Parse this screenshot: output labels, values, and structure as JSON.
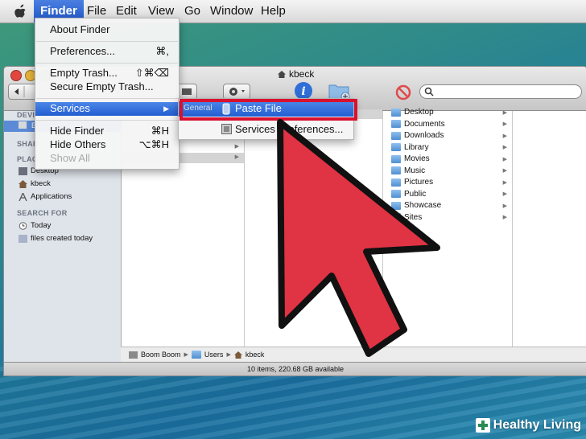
{
  "menubar": {
    "items": [
      "Finder",
      "File",
      "Edit",
      "View",
      "Go",
      "Window",
      "Help"
    ],
    "active_index": 0
  },
  "finder_menu": {
    "items": [
      {
        "label": "About Finder",
        "shortcut": ""
      },
      {
        "label": "Preferences...",
        "shortcut": "⌘,"
      },
      {
        "label": "Empty Trash...",
        "shortcut": "⇧⌘⌫"
      },
      {
        "label": "Secure Empty Trash...",
        "shortcut": ""
      },
      {
        "label": "Services",
        "shortcut": "▶"
      },
      {
        "label": "Hide Finder",
        "shortcut": "⌘H"
      },
      {
        "label": "Hide Others",
        "shortcut": "⌥⌘H"
      },
      {
        "label": "Show All",
        "shortcut": ""
      }
    ]
  },
  "services_menu": {
    "group": "General",
    "paste_label": "Paste File",
    "prefs_label": "Services Preferences..."
  },
  "window": {
    "title": "kbeck",
    "status": "10 items, 220.68 GB available"
  },
  "sidebar": {
    "heads": [
      "DEVI",
      "SHAR",
      "PLAC",
      "SEARCH FOR"
    ],
    "device_item": "B",
    "places": [
      "Desktop",
      "kbeck",
      "Applications"
    ],
    "search": [
      "Today",
      "files created today"
    ]
  },
  "columns": {
    "home_items": [
      "Desktop",
      "Documents",
      "Downloads",
      "Library",
      "Movies",
      "Music",
      "Pictures",
      "Public",
      "Showcase",
      "Sites"
    ]
  },
  "pathbar": [
    "Boom Boom",
    "Users",
    "kbeck"
  ],
  "watermark": "Healthy Living",
  "colors": {
    "highlight": "#2b63d6",
    "annotation": "#d8112e"
  }
}
